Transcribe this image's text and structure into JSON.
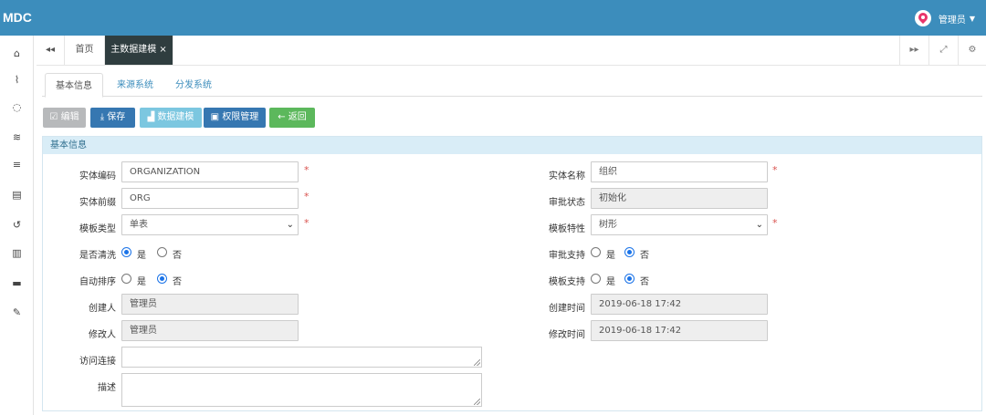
{
  "app": {
    "logo": "MDC"
  },
  "user": {
    "name": "管理员"
  },
  "sidebar": {
    "items": [
      {
        "name": "home-icon",
        "glyph": "⌂"
      },
      {
        "name": "chart-icon",
        "glyph": "⌇"
      },
      {
        "name": "spinner-icon",
        "glyph": "◌"
      },
      {
        "name": "database-icon",
        "glyph": "≋"
      },
      {
        "name": "list-icon",
        "glyph": "≡"
      },
      {
        "name": "card-icon",
        "glyph": "▤"
      },
      {
        "name": "history-icon",
        "glyph": "↺"
      },
      {
        "name": "film-icon",
        "glyph": "▥"
      },
      {
        "name": "archive-icon",
        "glyph": "▬"
      },
      {
        "name": "wrench-icon",
        "glyph": "✎"
      }
    ]
  },
  "tabs": {
    "back_glyph": "◂◂",
    "home": "首页",
    "active": "主数据建模",
    "close_glyph": "×",
    "forward_glyph": "▸▸",
    "fullscreen_glyph": "⤢",
    "settings_glyph": "⚙"
  },
  "subtabs": [
    "基本信息",
    "来源系统",
    "分发系统"
  ],
  "toolbar": {
    "edit": "编辑",
    "save": "保存",
    "model": "数据建模",
    "permission": "权限管理",
    "back": "返回"
  },
  "panel": {
    "title": "基本信息"
  },
  "form": {
    "entity_code": {
      "label": "实体编码",
      "value": "ORGANIZATION"
    },
    "entity_name": {
      "label": "实体名称",
      "value": "组织"
    },
    "entity_prefix": {
      "label": "实体前缀",
      "value": "ORG"
    },
    "approval_status": {
      "label": "审批状态",
      "value": "初始化"
    },
    "template_type": {
      "label": "模板类型",
      "value": "单表"
    },
    "template_feature": {
      "label": "模板特性",
      "value": "树形"
    },
    "is_clean": {
      "label": "是否清洗",
      "yes": "是",
      "no": "否",
      "selected": "yes"
    },
    "approval_support": {
      "label": "审批支持",
      "yes": "是",
      "no": "否",
      "selected": "no"
    },
    "auto_sort": {
      "label": "自动排序",
      "yes": "是",
      "no": "否",
      "selected": "no"
    },
    "template_support": {
      "label": "模板支持",
      "yes": "是",
      "no": "否",
      "selected": "no"
    },
    "creator": {
      "label": "创建人",
      "value": "管理员"
    },
    "create_time": {
      "label": "创建时间",
      "value": "2019-06-18 17:42"
    },
    "modifier": {
      "label": "修改人",
      "value": "管理员"
    },
    "modify_time": {
      "label": "修改时间",
      "value": "2019-06-18 17:42"
    },
    "access_link": {
      "label": "访问连接",
      "value": ""
    },
    "description": {
      "label": "描述",
      "value": ""
    },
    "required_mark": "*"
  },
  "colors": {
    "header": "#3c8dbc",
    "active_tab": "#2f3d3f",
    "primary": "#3677b1",
    "success": "#5cb85c",
    "panel_head": "#d9edf7"
  }
}
